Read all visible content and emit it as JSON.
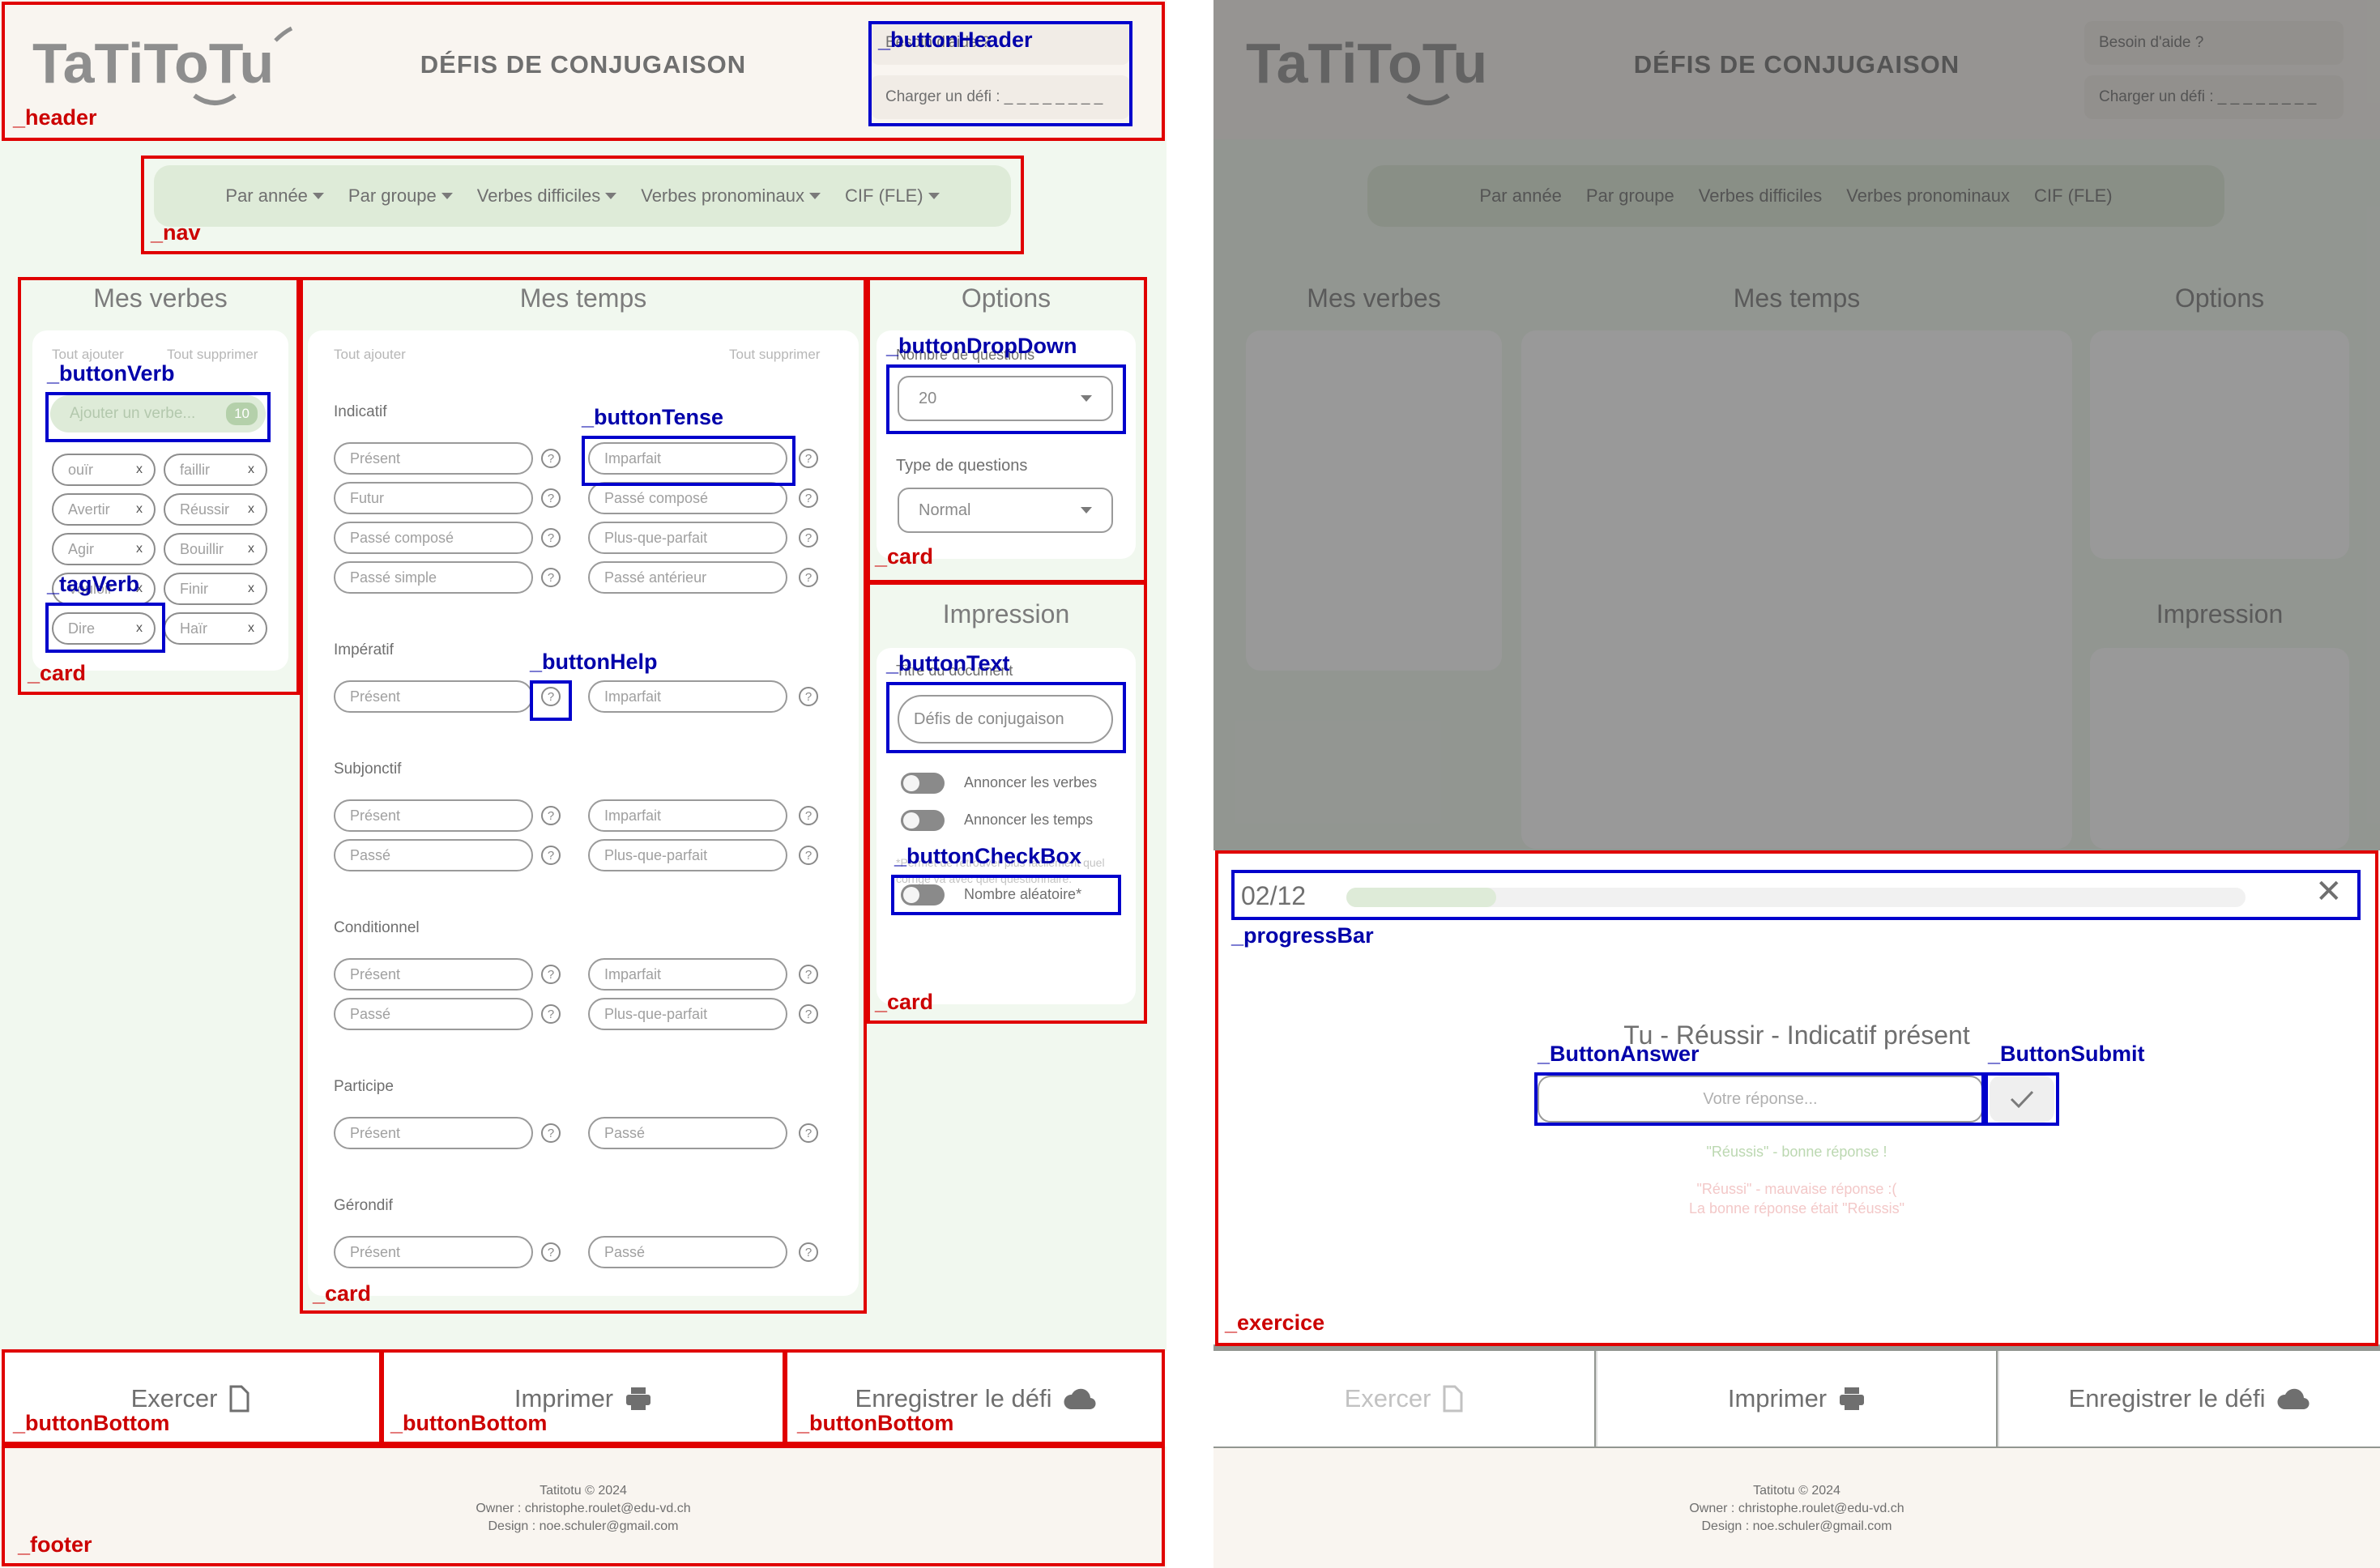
{
  "header": {
    "title": "DÉFIS DE CONJUGAISON",
    "help_button": "Besoin d'aide ?",
    "load_button": "Charger un défi : _ _ _ _ _ _ _ _"
  },
  "nav": {
    "items": [
      "Par année",
      "Par groupe",
      "Verbes difficiles",
      "Verbes pronominaux",
      "CIF (FLE)"
    ]
  },
  "verbs": {
    "title": "Mes verbes",
    "add_all": "Tout ajouter",
    "remove_all": "Tout supprimer",
    "input_placeholder": "Ajouter un verbe...",
    "count": "10",
    "tags": [
      "ouïr",
      "faillir",
      "Avertir",
      "Réussir",
      "Agir",
      "Bouillir",
      "Vouloir",
      "Finir",
      "Dire",
      "Haïr"
    ],
    "tag_close": "x"
  },
  "tenses": {
    "title": "Mes temps",
    "add_all": "Tout ajouter",
    "remove_all": "Tout supprimer",
    "help_glyph": "?",
    "groups": [
      {
        "name": "Indicatif",
        "left": [
          "Présent",
          "Futur",
          "Passé composé",
          "Passé simple"
        ],
        "right": [
          "Imparfait",
          "Passé composé",
          "Plus-que-parfait",
          "Passé antérieur"
        ]
      },
      {
        "name": "Impératif",
        "left": [
          "Présent"
        ],
        "right": [
          "Imparfait"
        ]
      },
      {
        "name": "Subjonctif",
        "left": [
          "Présent",
          "Passé"
        ],
        "right": [
          "Imparfait",
          "Plus-que-parfait"
        ]
      },
      {
        "name": "Conditionnel",
        "left": [
          "Présent",
          "Passé"
        ],
        "right": [
          "Imparfait",
          "Plus-que-parfait"
        ]
      },
      {
        "name": "Participe",
        "left": [
          "Présent"
        ],
        "right": [
          "Passé"
        ]
      },
      {
        "name": "Gérondif",
        "left": [
          "Présent"
        ],
        "right": [
          "Passé"
        ]
      }
    ]
  },
  "options": {
    "title": "Options",
    "count_label": "Nombre de questions",
    "count_value": "20",
    "type_label": "Type de questions",
    "type_value": "Normal"
  },
  "print": {
    "title": "Impression",
    "doc_label": "Titre du document",
    "doc_value": "Défis de conjugaison",
    "toggles": [
      "Annoncer les verbes",
      "Annoncer les temps",
      "Nombre aléatoire*"
    ],
    "note": "*Permet de retrouver plus facilement quel corrigé va avec quel questionnaire."
  },
  "bottom": {
    "exercise": "Exercer",
    "print": "Imprimer",
    "save": "Enregistrer le défi"
  },
  "footer": {
    "line1": "Tatitotu © 2024",
    "line2": "Owner : christophe.roulet@edu-vd.ch",
    "line3": "Design : noe.schuler@gmail.com"
  },
  "exercise": {
    "progress_label": "02/12",
    "progress": 0.167,
    "prompt": "Tu - Réussir - Indicatif présent",
    "placeholder": "Votre réponse...",
    "good": "\"Réussis\" - bonne réponse !",
    "bad1": "\"Réussi\" - mauvaise réponse :(",
    "bad2": "La bonne réponse était \"Réussis\"",
    "close": "✕"
  },
  "annotations": {
    "header": "_header",
    "nav": "_nav",
    "card": "_card",
    "buttonHeader": "_buttonHeader",
    "buttonVerb": "_buttonVerb",
    "tagVerb": "_tagVerb",
    "buttonTense": "_buttonTense",
    "buttonHelp": "_buttonHelp",
    "buttonDropDown": "_buttonDropDown",
    "buttonText": "_buttonText",
    "buttonCheckBox": "_buttonCheckBox",
    "buttonBottom": "_buttonBottom",
    "footer": "_footer",
    "progressBar": "_progressBar",
    "buttonAnswer": "_ButtonAnswer",
    "buttonSubmit": "_ButtonSubmit",
    "exercice": "_exercice"
  },
  "colors": {
    "background": "#f1f8ef",
    "header": "#f9f5f0",
    "nav": "#deebd8",
    "annotation_red": "#e00000",
    "annotation_blue": "#0000cc"
  }
}
